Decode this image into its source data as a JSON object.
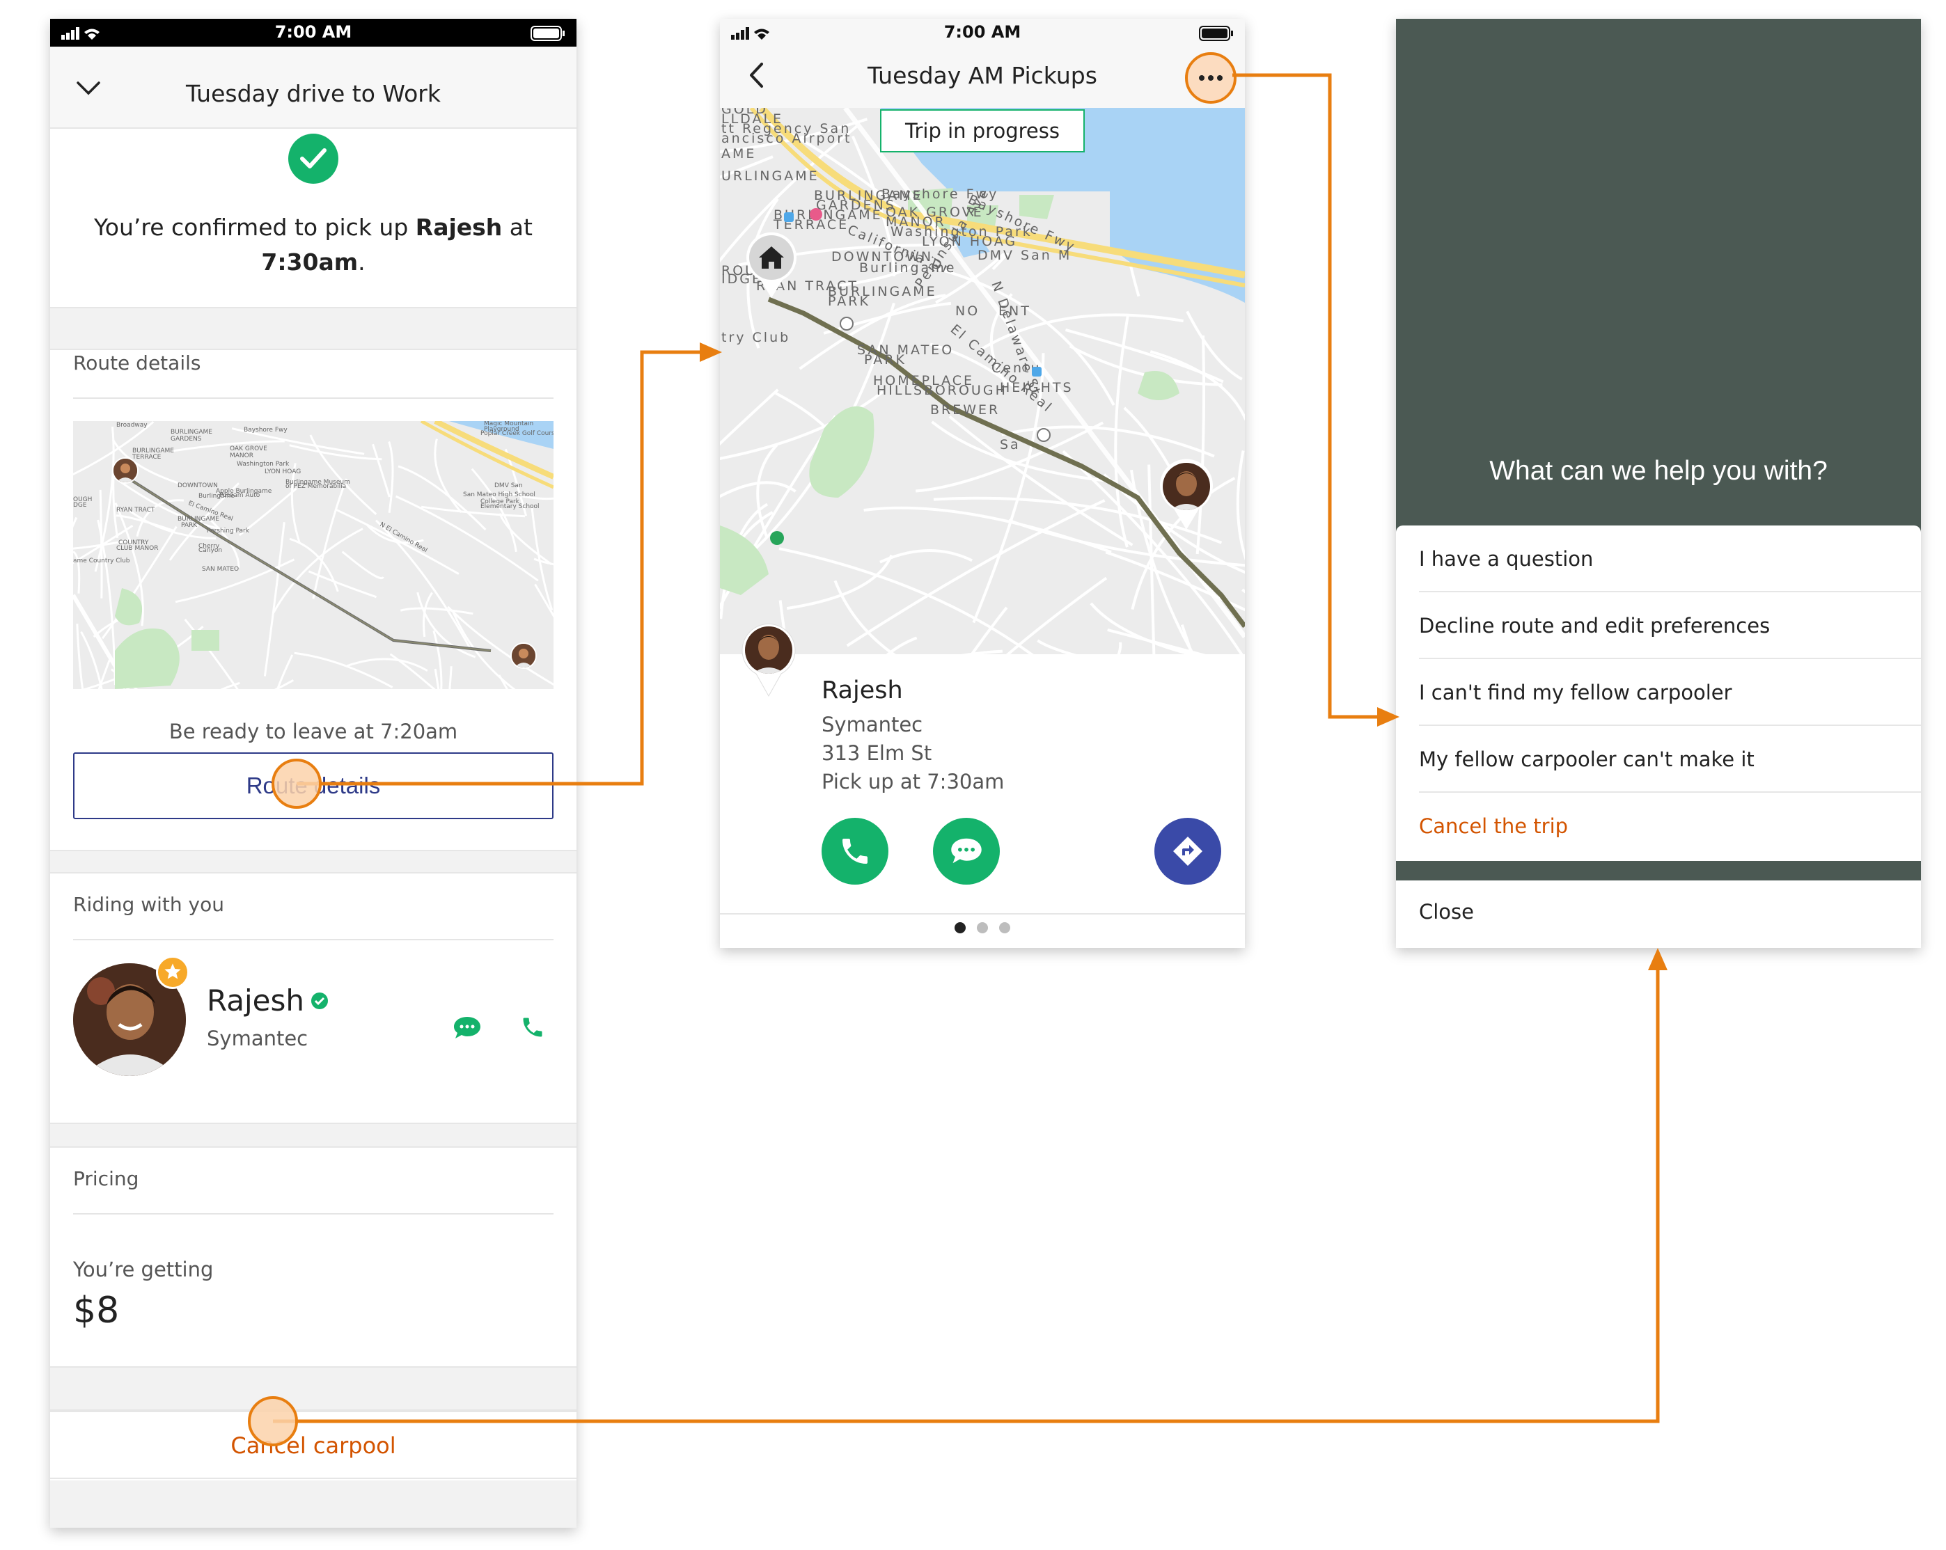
{
  "status_time": "7:00 AM",
  "screen1": {
    "title": "Tuesday drive to Work",
    "confirm_prefix": "You’re confirmed to pick up ",
    "confirm_name": "Rajesh",
    "confirm_mid": " at",
    "confirm_time": "7:30am",
    "confirm_suffix": ".",
    "route_section_label": "Route details",
    "ready_text": "Be ready to leave at 7:20am",
    "route_button": "Route details",
    "riding_label": "Riding with you",
    "rider_name": "Rajesh",
    "rider_company": "Symantec",
    "pricing_label": "Pricing",
    "getting_label": "You’re getting",
    "price": "$8",
    "cancel_label": "Cancel carpool"
  },
  "screen2": {
    "title": "Tuesday AM Pickups",
    "trip_status": "Trip in progress",
    "pickup": {
      "name": "Rajesh",
      "company": "Symantec",
      "address": "313 Elm St",
      "time": "Pick up at 7:30am"
    },
    "page_count": 3,
    "active_page": 1,
    "map_labels": [
      "GOLD",
      "LLDALE",
      "tt Regency San",
      "ancisco Airport",
      "AME",
      "URLINGAME",
      "BURLINGAME",
      "GARDENS",
      "Bayshore Fwy",
      "Bayshore Fwy",
      "BURLINGAME",
      "TERRACE",
      "OAK GROVE",
      "MANOR",
      "Washington Park",
      "California Dr",
      "LYON HOAG",
      "DMV San M",
      "DOWNTOWN",
      "Burlingame",
      "ROUGH",
      "IDGE",
      "RYAN TRACT",
      "BURLINGAME",
      "PARK",
      "Peninsula Ave",
      "N Delaware St",
      "NO",
      "ENT",
      "El Camino Real",
      "try Club",
      "SAN MATEO",
      "PARK",
      "Centu",
      "HOMEPLACE",
      "HILLSBOROUGH",
      "HEIGHTS",
      "Sa",
      "BREWER"
    ]
  },
  "minimap_labels": [
    "Broadway",
    "BURLINGAME",
    "GARDENS",
    "Bayshore Fwy",
    "Magic Mountain",
    "Playground",
    "Poplar Creek Golf Course",
    "BURLINGAME",
    "TERRACE",
    "OAK GROVE",
    "MANOR",
    "Washington Park",
    "LYON HOAG",
    "Burlingame Museum",
    "of PEZ Memorabilia",
    "DOWNTOWN",
    "Burlingame",
    "Apple Burlingame",
    "Putnam Auto",
    "DMV San",
    "San Mateo High School",
    "OUGH",
    "DGE",
    "RYAN TRACT",
    "El Camino Real",
    "College Park",
    "Elementary School",
    "BURLINGAME",
    "PARK",
    "Pershing Park",
    "COUNTRY",
    "CLUB MANOR",
    "Cherry",
    "Canyon",
    "ame Country Club",
    "SAN MATEO",
    "N El Camino Real"
  ],
  "screen3": {
    "question": "What can we help you with?",
    "options": [
      "I have a question",
      "Decline route and edit preferences",
      "I can't find my fellow carpooler",
      "My fellow carpooler can't make it",
      "Cancel the trip"
    ],
    "close": "Close"
  },
  "colors": {
    "brand_green": "#14b26b",
    "brand_blue": "#2e3a88",
    "directions_blue": "#3a4aa8",
    "danger_orange": "#d35400",
    "annotation_orange": "#e87e10",
    "overlay": "#4b5953",
    "map_water": "#a9d3f5",
    "map_park": "#c8e8c2",
    "map_highway": "#f7dc7a",
    "route_line": "#7a7a5c"
  },
  "icons": [
    "chevron-down-icon",
    "checkmark-icon",
    "star-icon",
    "verified-icon",
    "message-icon",
    "phone-icon",
    "back-arrow-icon",
    "more-icon",
    "home-icon",
    "directions-icon",
    "signal-icon",
    "wifi-icon",
    "battery-icon"
  ]
}
